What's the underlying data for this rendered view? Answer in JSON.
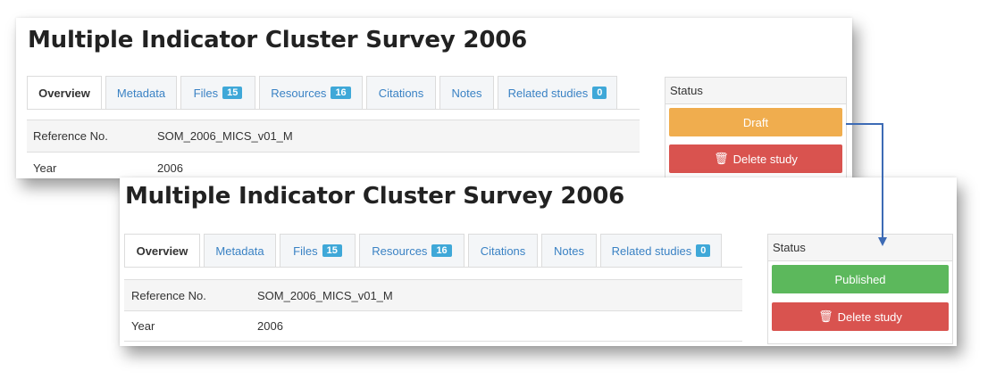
{
  "before": {
    "title": "Multiple Indicator Cluster Survey 2006",
    "tabs": [
      {
        "label": "Overview",
        "badge": null
      },
      {
        "label": "Metadata",
        "badge": null
      },
      {
        "label": "Files",
        "badge": "15"
      },
      {
        "label": "Resources",
        "badge": "16"
      },
      {
        "label": "Citations",
        "badge": null
      },
      {
        "label": "Notes",
        "badge": null
      },
      {
        "label": "Related studies",
        "badge": "0"
      }
    ],
    "rows": [
      {
        "label": "Reference No.",
        "value": "SOM_2006_MICS_v01_M"
      },
      {
        "label": "Year",
        "value": "2006"
      }
    ],
    "status_header": "Status",
    "status_button": "Draft",
    "delete_button": "Delete study"
  },
  "after": {
    "title": "Multiple Indicator Cluster Survey 2006",
    "tabs": [
      {
        "label": "Overview",
        "badge": null
      },
      {
        "label": "Metadata",
        "badge": null
      },
      {
        "label": "Files",
        "badge": "15"
      },
      {
        "label": "Resources",
        "badge": "16"
      },
      {
        "label": "Citations",
        "badge": null
      },
      {
        "label": "Notes",
        "badge": null
      },
      {
        "label": "Related studies",
        "badge": "0"
      }
    ],
    "rows": [
      {
        "label": "Reference No.",
        "value": "SOM_2006_MICS_v01_M"
      },
      {
        "label": "Year",
        "value": "2006"
      }
    ],
    "status_header": "Status",
    "status_button": "Published",
    "delete_button": "Delete study"
  },
  "colors": {
    "draft": "#f0ad4e",
    "published": "#5cb85c",
    "delete": "#d9534f",
    "badge": "#3fa8d8",
    "link": "#3a82c4",
    "arrow": "#3d6bb5"
  },
  "icons": {
    "trash": "trash-icon",
    "arrow": "arrow-connector"
  }
}
